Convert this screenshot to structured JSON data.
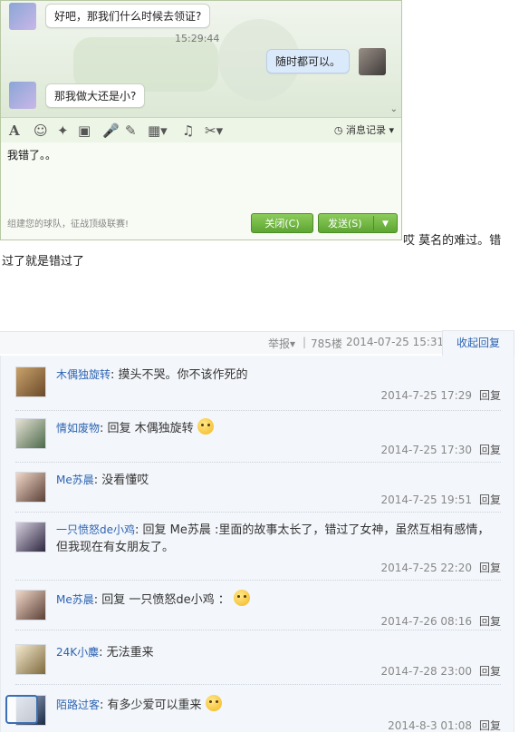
{
  "chat": {
    "messages": [
      {
        "side": "left",
        "text": "好吧，那我们什么时候去领证?"
      },
      {
        "side": "right",
        "text": "随时都可以。"
      },
      {
        "side": "left",
        "text": "那我做大还是小?"
      }
    ],
    "timestamp": "15:29:44",
    "history_label": "消息记录",
    "input_text": "我错了。。",
    "footer_tip": "组建您的球队，征战顶级联赛!",
    "close_label": "关闭(C)",
    "send_label": "发送(S)"
  },
  "caption": {
    "line1": "哎 莫名的难过。错",
    "line2": "过了就是错过了"
  },
  "thread": {
    "report": "举报",
    "floor": "785楼",
    "time": "2014-07-25 15:31",
    "collapse": "收起回复",
    "reply_label": "回复",
    "replies": [
      {
        "user": "木偶独旋转",
        "text": "摸头不哭。你不该作死的",
        "time": "2014-7-25 17:29"
      },
      {
        "user": "情如废物",
        "text": "回复 木偶独旋转 ",
        "time": "2014-7-25 17:30"
      },
      {
        "user": "Me苏晨",
        "text": "没看懂哎",
        "time": "2014-7-25 19:51"
      },
      {
        "user": "一只愤怒de小鸡",
        "text": "回复 Me苏晨 :里面的故事太长了，错过了女神，虽然互相有感情，但我现在有女朋友了。",
        "time": "2014-7-25 22:20"
      },
      {
        "user": "Me苏晨",
        "text": "回复 一只愤怒de小鸡 ：",
        "time": "2014-7-26 08:16"
      },
      {
        "user": "24K小麋",
        "text": "无法重来",
        "time": "2014-7-28 23:00"
      },
      {
        "user": "陌路过客",
        "text": "有多少爱可以重来",
        "time": "2014-8-3 01:08"
      }
    ]
  },
  "colors": {
    "accent_green": "#5ea532",
    "link_blue": "#2d64b3"
  }
}
